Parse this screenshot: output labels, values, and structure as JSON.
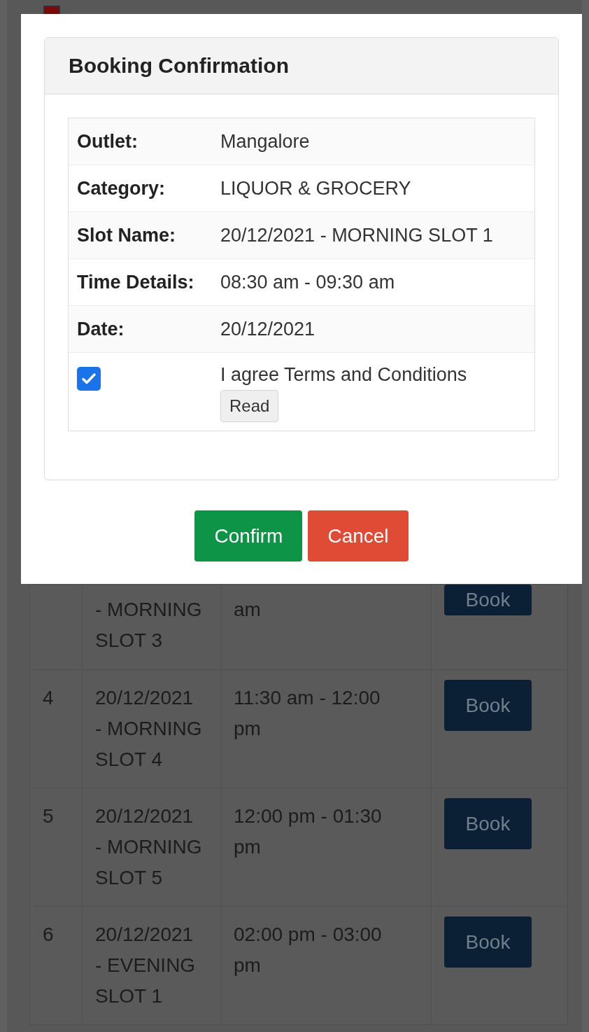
{
  "legend": {
    "color": "#7a0a0a"
  },
  "dialog": {
    "title": "Booking Confirmation",
    "details": [
      {
        "label": "Outlet:",
        "value": "Mangalore"
      },
      {
        "label": "Category:",
        "value": "LIQUOR & GROCERY"
      },
      {
        "label": "Slot Name:",
        "value": "20/12/2021 - MORNING SLOT 1"
      },
      {
        "label": "Time Details:",
        "value": "08:30 am - 09:30 am"
      },
      {
        "label": "Date:",
        "value": "20/12/2021"
      }
    ],
    "agree": {
      "checked": true,
      "text": "I agree Terms and Conditions",
      "read_button": "Read"
    },
    "buttons": [
      {
        "label": "Confirm",
        "kind": "primary"
      },
      {
        "label": "Cancel",
        "kind": "danger"
      }
    ]
  },
  "slots": [
    {
      "slot": "- MORNING\nSLOT 3",
      "time": "am",
      "action": "Book",
      "kind": "partial"
    },
    {
      "number": "4",
      "slot": "20/12/2021\n- MORNING\nSLOT 4",
      "time": "11:30 am - 12:00\npm",
      "action": "Book",
      "kind": "full"
    },
    {
      "number": "5",
      "slot": "20/12/2021\n- MORNING\nSLOT 5",
      "time": "12:00 pm - 01:30\npm",
      "action": "Book",
      "kind": "full"
    },
    {
      "number": "6",
      "slot": "20/12/2021\n- EVENING\nSLOT 1",
      "time": "02:00 pm - 03:00\npm",
      "action": "Book",
      "kind": "full"
    }
  ]
}
